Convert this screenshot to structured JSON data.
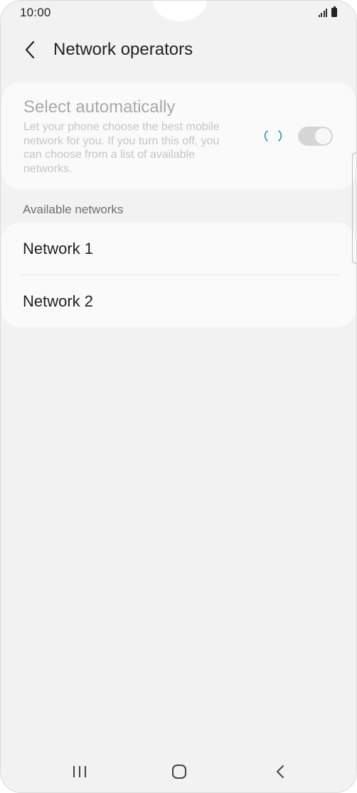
{
  "status_bar": {
    "time": "10:00",
    "signal_icon": "signal-icon",
    "battery_icon": "battery-icon"
  },
  "header": {
    "title": "Network operators",
    "back_icon": "chevron-left-icon"
  },
  "select_automatically": {
    "title": "Select automatically",
    "description": "Let your phone choose the best mobile network for you. If you turn this off, you can choose from a list of available networks.",
    "enabled": true,
    "loading": true,
    "accent_color": "#1a9ab0"
  },
  "available_networks": {
    "section_label": "Available networks",
    "items": [
      {
        "label": "Network 1"
      },
      {
        "label": "Network 2"
      }
    ]
  },
  "nav_bar": {
    "recents_icon": "recents-icon",
    "home_icon": "home-icon",
    "back_icon": "back-icon"
  }
}
